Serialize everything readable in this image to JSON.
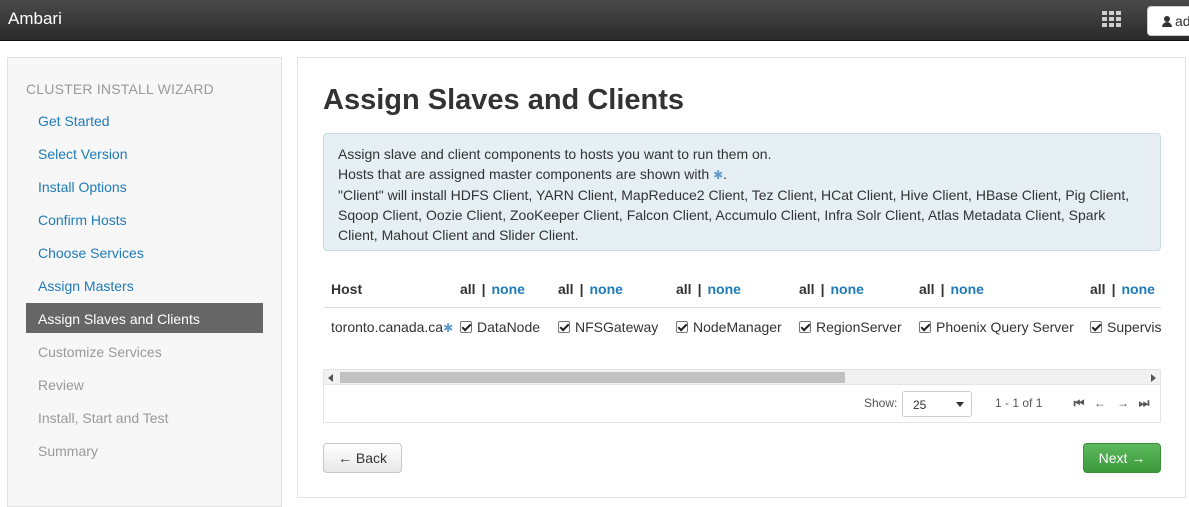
{
  "topbar": {
    "brand": "Ambari",
    "user_label": "ad"
  },
  "sidebar": {
    "title": "CLUSTER INSTALL WIZARD",
    "items": [
      {
        "label": "Get Started",
        "state": "link"
      },
      {
        "label": "Select Version",
        "state": "link"
      },
      {
        "label": "Install Options",
        "state": "link"
      },
      {
        "label": "Confirm Hosts",
        "state": "link"
      },
      {
        "label": "Choose Services",
        "state": "link"
      },
      {
        "label": "Assign Masters",
        "state": "link"
      },
      {
        "label": "Assign Slaves and Clients",
        "state": "active"
      },
      {
        "label": "Customize Services",
        "state": "disabled"
      },
      {
        "label": "Review",
        "state": "disabled"
      },
      {
        "label": "Install, Start and Test",
        "state": "disabled"
      },
      {
        "label": "Summary",
        "state": "disabled"
      }
    ]
  },
  "main": {
    "title": "Assign Slaves and Clients",
    "alert": {
      "line1": "Assign slave and client components to hosts you want to run them on.",
      "line2": "Hosts that are assigned master components are shown with",
      "line2_star": "✱",
      "line2_end": ".",
      "line3": "\"Client\" will install HDFS Client, YARN Client, MapReduce2 Client, Tez Client, HCat Client, Hive Client, HBase Client, Pig Client, Sqoop Client, Oozie Client, ZooKeeper Client, Falcon Client, Accumulo Client, Infra Solr Client, Atlas Metadata Client, Spark Client, Mahout Client and Slider Client."
    },
    "table": {
      "host_header": "Host",
      "all_label": "all",
      "sep": "|",
      "none_label": "none",
      "host": "toronto.canada.ca",
      "host_star": "✱",
      "components": [
        "DataNode",
        "NFSGateway",
        "NodeManager",
        "RegionServer",
        "Phoenix Query Server",
        "Supervisor"
      ],
      "checked": [
        true,
        true,
        true,
        true,
        true,
        true
      ]
    },
    "pager": {
      "show_label": "Show:",
      "page_size": "25",
      "range": "1 - 1 of 1"
    },
    "buttons": {
      "back": "← Back",
      "next": "Next →"
    }
  }
}
